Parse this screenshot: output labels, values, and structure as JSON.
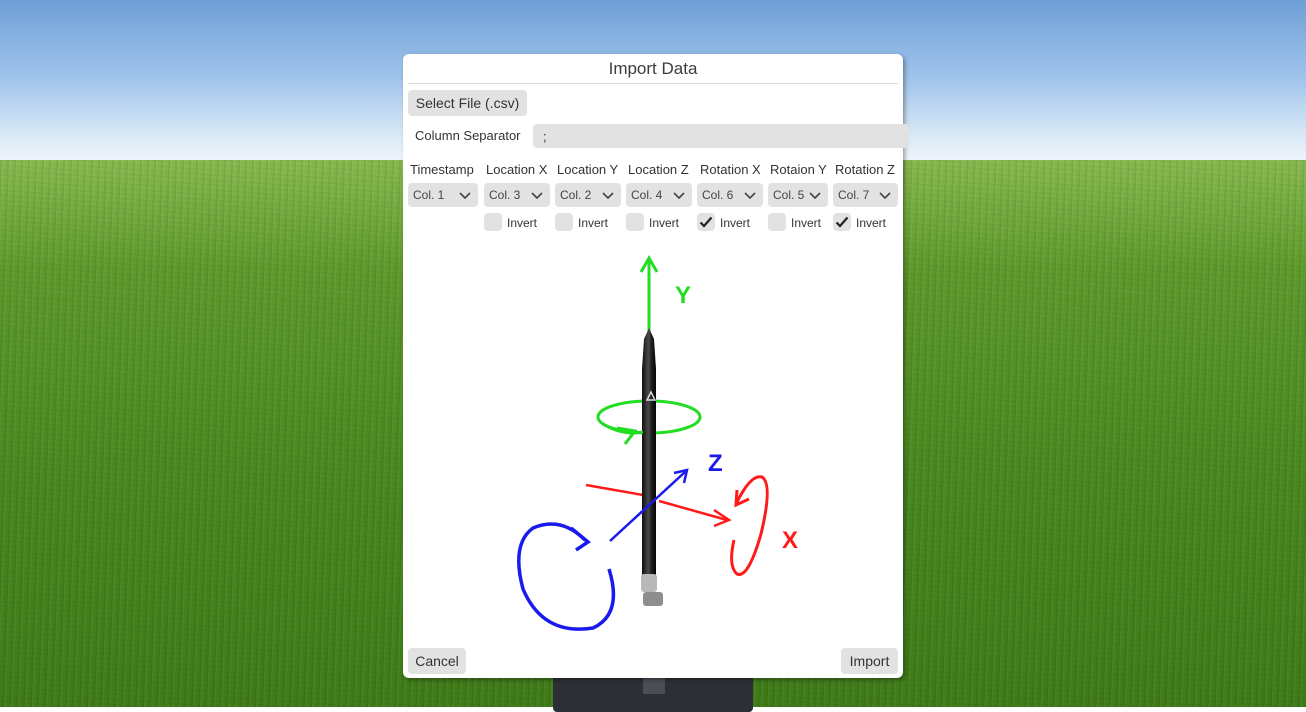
{
  "dialog": {
    "title": "Import Data",
    "select_file_label": "Select File (.csv)",
    "separator_label": "Column Separator",
    "separator_value": ";",
    "cancel_label": "Cancel",
    "import_label": "Import"
  },
  "columns": [
    {
      "header": "Timestamp",
      "selected": "Col. 1",
      "has_invert": false,
      "invert": false
    },
    {
      "header": "Location X",
      "selected": "Col. 3",
      "has_invert": true,
      "invert": false
    },
    {
      "header": "Location Y",
      "selected": "Col. 2",
      "has_invert": true,
      "invert": false
    },
    {
      "header": "Location Z",
      "selected": "Col. 4",
      "has_invert": true,
      "invert": false
    },
    {
      "header": "Rotation X",
      "selected": "Col. 6",
      "has_invert": true,
      "invert": true
    },
    {
      "header": "Rotaion Y",
      "selected": "Col. 5",
      "has_invert": true,
      "invert": false
    },
    {
      "header": "Rotation Z",
      "selected": "Col. 7",
      "has_invert": true,
      "invert": true
    }
  ],
  "invert_label": "Invert",
  "axes": {
    "x": "X",
    "y": "Y",
    "z": "Z"
  },
  "colors": {
    "x_axis": "#ff1a1a",
    "y_axis": "#22dd22",
    "z_axis": "#1a1aee",
    "control_bg": "#e2e2e2"
  },
  "icons": [
    "chevron-down-icon",
    "checkmark-icon",
    "pen-logo-icon"
  ]
}
